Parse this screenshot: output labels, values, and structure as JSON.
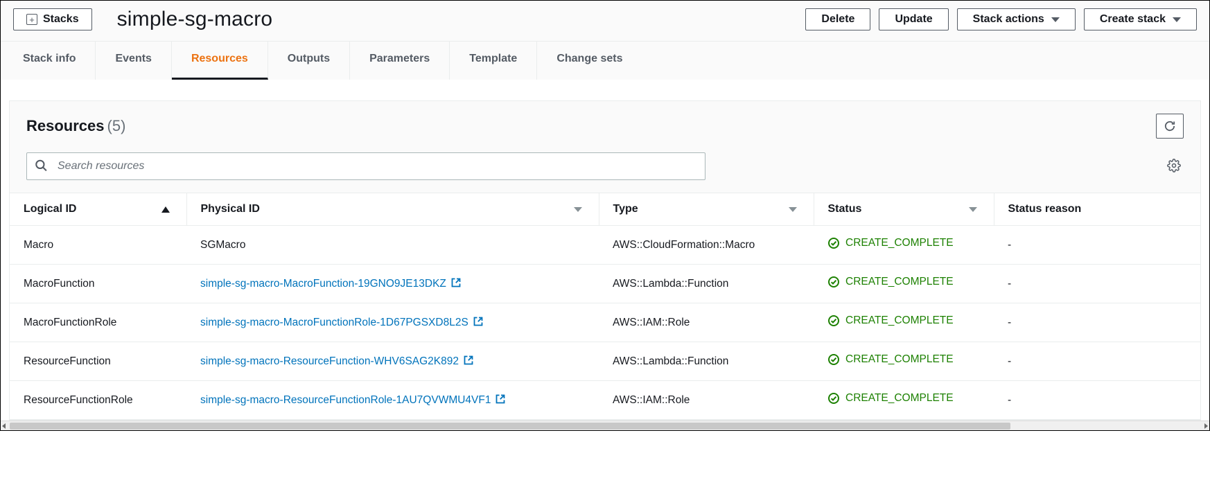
{
  "header": {
    "stacks_label": "Stacks",
    "title": "simple-sg-macro",
    "actions": {
      "delete": "Delete",
      "update": "Update",
      "stack_actions": "Stack actions",
      "create_stack": "Create stack"
    }
  },
  "tabs": [
    {
      "label": "Stack info",
      "id": "stack-info",
      "active": false
    },
    {
      "label": "Events",
      "id": "events",
      "active": false
    },
    {
      "label": "Resources",
      "id": "resources",
      "active": true
    },
    {
      "label": "Outputs",
      "id": "outputs",
      "active": false
    },
    {
      "label": "Parameters",
      "id": "parameters",
      "active": false
    },
    {
      "label": "Template",
      "id": "template",
      "active": false
    },
    {
      "label": "Change sets",
      "id": "change-sets",
      "active": false
    }
  ],
  "panel": {
    "title": "Resources",
    "count_display": "(5)",
    "search_placeholder": "Search resources"
  },
  "columns": {
    "logical_id": "Logical ID",
    "physical_id": "Physical ID",
    "type": "Type",
    "status": "Status",
    "status_reason": "Status reason"
  },
  "rows": [
    {
      "logical_id": "Macro",
      "physical_id": "SGMacro",
      "physical_id_link": false,
      "type": "AWS::CloudFormation::Macro",
      "status": "CREATE_COMPLETE",
      "status_reason": "-"
    },
    {
      "logical_id": "MacroFunction",
      "physical_id": "simple-sg-macro-MacroFunction-19GNO9JE13DKZ",
      "physical_id_link": true,
      "type": "AWS::Lambda::Function",
      "status": "CREATE_COMPLETE",
      "status_reason": "-"
    },
    {
      "logical_id": "MacroFunctionRole",
      "physical_id": "simple-sg-macro-MacroFunctionRole-1D67PGSXD8L2S",
      "physical_id_link": true,
      "type": "AWS::IAM::Role",
      "status": "CREATE_COMPLETE",
      "status_reason": "-"
    },
    {
      "logical_id": "ResourceFunction",
      "physical_id": "simple-sg-macro-ResourceFunction-WHV6SAG2K892",
      "physical_id_link": true,
      "type": "AWS::Lambda::Function",
      "status": "CREATE_COMPLETE",
      "status_reason": "-"
    },
    {
      "logical_id": "ResourceFunctionRole",
      "physical_id": "simple-sg-macro-ResourceFunctionRole-1AU7QVWMU4VF1",
      "physical_id_link": true,
      "type": "AWS::IAM::Role",
      "status": "CREATE_COMPLETE",
      "status_reason": "-"
    }
  ],
  "colors": {
    "accent": "#ec7211",
    "link": "#0073bb",
    "success": "#1d8102"
  }
}
